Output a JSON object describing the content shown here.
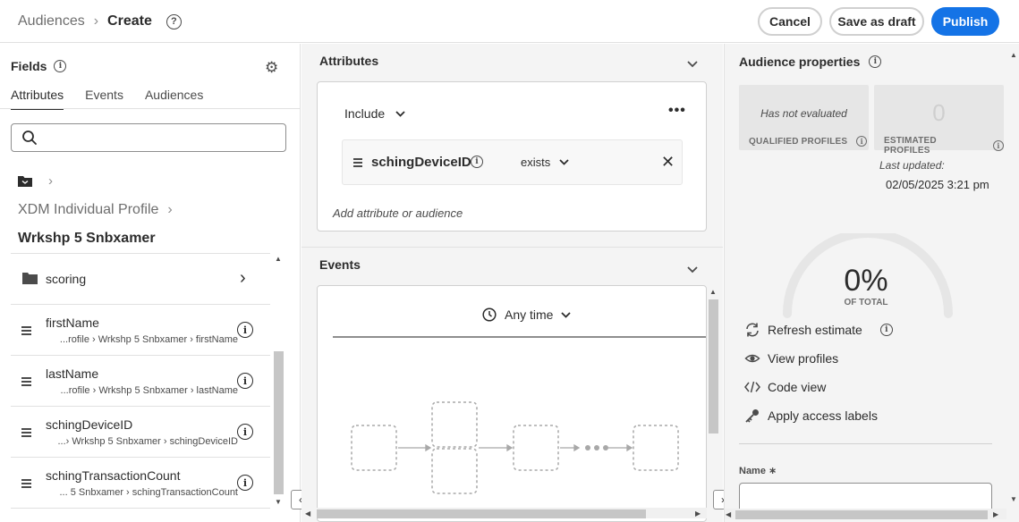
{
  "header": {
    "breadcrumb_parent": "Audiences",
    "breadcrumb_sep": "›",
    "breadcrumb_current": "Create",
    "help_icon": "?",
    "cancel_label": "Cancel",
    "save_draft_label": "Save as draft",
    "publish_label": "Publish"
  },
  "fields": {
    "title": "Fields",
    "info_icon": "i",
    "tabs": [
      "Attributes",
      "Events",
      "Audiences"
    ],
    "active_tab": "Attributes",
    "search_placeholder": "",
    "path_root_chevron": "›",
    "xdm_label": "XDM Individual Profile",
    "xdm_chevron": "›",
    "sandbox_label": "Wrkshp 5 Snbxamer",
    "items": [
      {
        "name": "scoring",
        "type": "folder",
        "chevron": "›"
      },
      {
        "name": "firstName",
        "path": "...rofile › Wrkshp 5 Snbxamer › firstName",
        "info": "i"
      },
      {
        "name": "lastName",
        "path": "...rofile › Wrkshp 5 Snbxamer › lastName",
        "info": "i"
      },
      {
        "name": "schingDeviceID",
        "path": "...› Wrkshp 5 Snbxamer › schingDeviceID",
        "info": "i"
      },
      {
        "name": "schingTransactionCount",
        "path": "... 5 Snbxamer › schingTransactionCount",
        "info": "i"
      }
    ],
    "collapse_arrow": "‹"
  },
  "attributes": {
    "title": "Attributes",
    "include_label": "Include",
    "more_label": "•••",
    "condition": {
      "attribute": "schingDeviceID",
      "info": "i",
      "operator": "exists",
      "remove": "✕"
    },
    "add_placeholder": "Add attribute or audience"
  },
  "events": {
    "title": "Events",
    "time_label": "Any time",
    "expand_arrow": "›"
  },
  "audience_properties": {
    "title": "Audience properties",
    "info_icon": "i",
    "qualified_value": "Has not evaluated",
    "qualified_label": "QUALIFIED PROFILES",
    "estimated_value": "0",
    "estimated_label": "ESTIMATED PROFILES",
    "last_updated_label": "Last updated:",
    "last_updated_value": "02/05/2025 3:21 pm",
    "percent": "0%",
    "of_total": "OF TOTAL",
    "actions": [
      {
        "label": "Refresh estimate",
        "icon": "refresh-icon",
        "info": "i"
      },
      {
        "label": "View profiles",
        "icon": "eye-icon"
      },
      {
        "label": "Code view",
        "icon": "code-icon"
      },
      {
        "label": "Apply access labels",
        "icon": "key-icon"
      }
    ],
    "name_label": "Name ∗",
    "name_value": ""
  },
  "colors": {
    "primary": "#1473e6",
    "panel_bg": "#f4f4f4"
  }
}
